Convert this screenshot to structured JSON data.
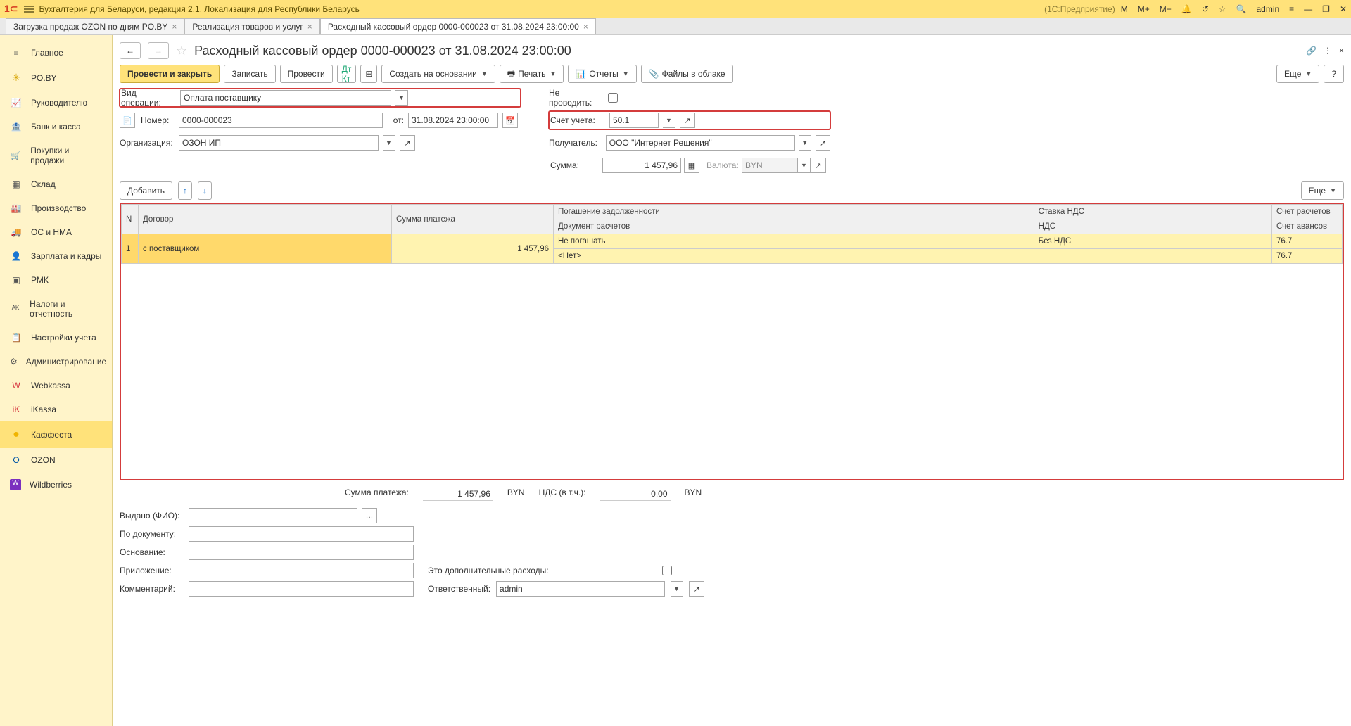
{
  "titlebar": {
    "app_title": "Бухгалтерия для Беларуси, редакция 2.1. Локализация для Республики Беларусь",
    "platform": "(1С:Предприятие)",
    "user": "admin",
    "icons": {
      "m": "M",
      "mplus": "M+",
      "mminus": "M−",
      "bell": "🔔",
      "history": "↺",
      "star": "☆",
      "search": "🔍",
      "menu": "≡",
      "min": "—",
      "restore": "❐",
      "close": "✕"
    }
  },
  "tabs": [
    {
      "label": "Загрузка продаж OZON по дням PO.BY",
      "active": false
    },
    {
      "label": "Реализация товаров и услуг",
      "active": false
    },
    {
      "label": "Расходный кассовый ордер 0000-000023 от 31.08.2024 23:00:00",
      "active": true
    }
  ],
  "sidebar": [
    {
      "icon": "≡",
      "label": "Главное"
    },
    {
      "icon": "✳",
      "label": "PO.BY"
    },
    {
      "icon": "📈",
      "label": "Руководителю"
    },
    {
      "icon": "🏦",
      "label": "Банк и касса"
    },
    {
      "icon": "🛒",
      "label": "Покупки и продажи"
    },
    {
      "icon": "▦",
      "label": "Склад"
    },
    {
      "icon": "🏭",
      "label": "Производство"
    },
    {
      "icon": "🚚",
      "label": "ОС и НМА"
    },
    {
      "icon": "👤",
      "label": "Зарплата и кадры"
    },
    {
      "icon": "▣",
      "label": "РМК"
    },
    {
      "icon": "ᴬᴷ",
      "label": "Налоги и отчетность"
    },
    {
      "icon": "📋",
      "label": "Настройки учета"
    },
    {
      "icon": "⚙",
      "label": "Администрирование"
    },
    {
      "icon": "W",
      "label": "Webkassa"
    },
    {
      "icon": "iK",
      "label": "iKassa"
    },
    {
      "icon": "●",
      "label": "Каффеста"
    },
    {
      "icon": "O",
      "label": "OZON"
    },
    {
      "icon": "W",
      "label": "Wildberries"
    }
  ],
  "doc": {
    "title": "Расходный кассовый ордер 0000-000023 от 31.08.2024 23:00:00",
    "toolbar": {
      "post_close": "Провести и закрыть",
      "write": "Записать",
      "post": "Провести",
      "create_based": "Создать на основании",
      "print": "Печать",
      "reports": "Отчеты",
      "cloud": "Файлы в облаке",
      "more": "Еще",
      "help": "?"
    },
    "left": {
      "op_type_label": "Вид операции:",
      "op_type": "Оплата поставщику",
      "number_label": "Номер:",
      "number": "0000-000023",
      "date_label": "от:",
      "date": "31.08.2024 23:00:00",
      "org_label": "Организация:",
      "org": "ОЗОН ИП"
    },
    "right": {
      "no_post_label": "Не проводить:",
      "account_label": "Счет учета:",
      "account": "50.1",
      "payee_label": "Получатель:",
      "payee": "ООО \"Интернет Решения\"",
      "sum_label": "Сумма:",
      "sum": "1 457,96",
      "currency_label": "Валюта:",
      "currency": "BYN"
    },
    "add_btn": "Добавить",
    "table": {
      "headers": {
        "n": "N",
        "contract": "Договор",
        "pay_sum": "Сумма платежа",
        "debt": "Погашение задолженности",
        "doc": "Документ расчетов",
        "vat_rate": "Ставка НДС",
        "vat": "НДС",
        "acct": "Счет расчетов",
        "adv": "Счет авансов"
      },
      "rows": [
        {
          "n": "1",
          "contract": "с поставщиком",
          "sum": "1 457,96",
          "debt": "Не погашать",
          "doc": "<Нет>",
          "vat_rate": "Без НДС",
          "vat": "",
          "acct": "76.7",
          "adv": "76.7"
        }
      ]
    },
    "totals": {
      "pay_label": "Сумма платежа:",
      "pay": "1 457,96",
      "pay_cur": "BYN",
      "vat_label": "НДС (в т.ч.):",
      "vat": "0,00",
      "vat_cur": "BYN"
    },
    "bottom": {
      "issued_label": "Выдано (ФИО):",
      "by_doc_label": "По документу:",
      "basis_label": "Основание:",
      "attach_label": "Приложение:",
      "comment_label": "Комментарий:",
      "extra_label": "Это дополнительные расходы:",
      "resp_label": "Ответственный:",
      "resp": "admin"
    }
  }
}
